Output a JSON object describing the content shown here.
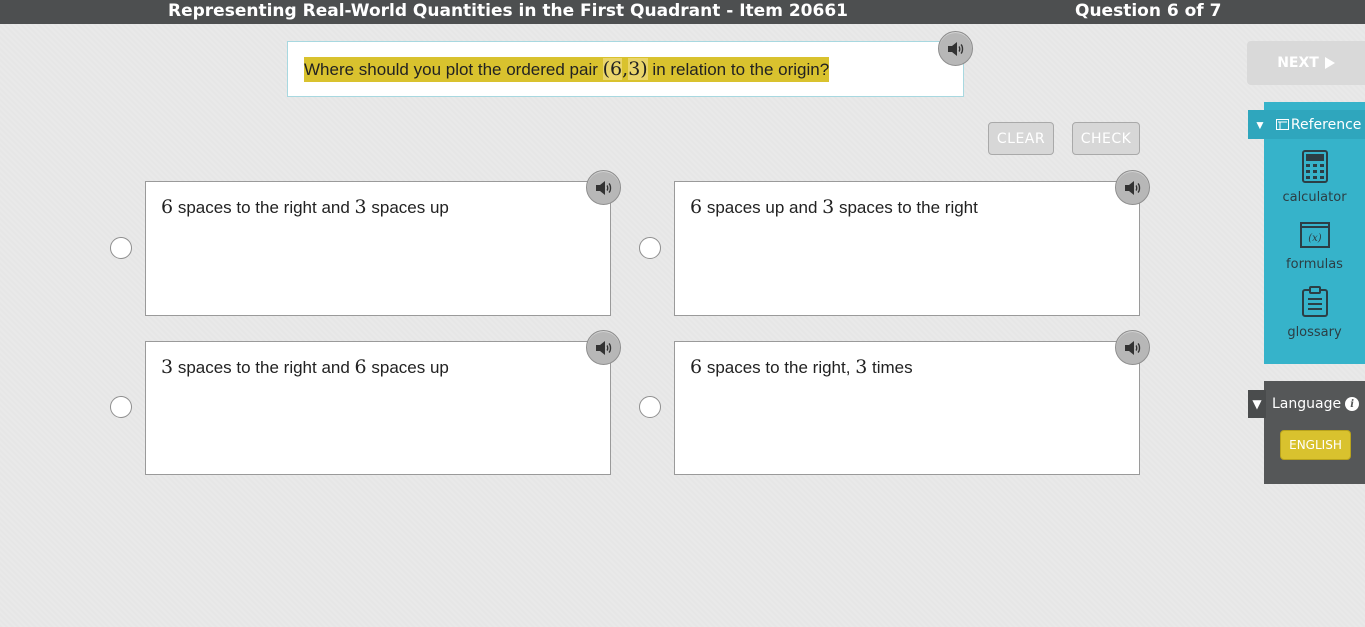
{
  "header": {
    "title": "Representing Real-World Quantities in the First Quadrant - Item 20661",
    "question_count": "Question 6 of 7"
  },
  "question": {
    "text_before": "Where should you plot the ordered pair ",
    "pair_open": "(",
    "pair_x": "6",
    "pair_sep": ",",
    "pair_y": "3",
    "pair_close": ")",
    "text_after": " in relation to the origin?"
  },
  "actions": {
    "clear_label": "CLEAR",
    "check_label": "CHECK",
    "next_label": "NEXT"
  },
  "choices": [
    {
      "num1": "6",
      "text1": " spaces to the right and ",
      "num2": "3",
      "text2": " spaces up"
    },
    {
      "num1": "6",
      "text1": " spaces up and ",
      "num2": "3",
      "text2": " spaces to the right"
    },
    {
      "num1": "3",
      "text1": " spaces to the right and ",
      "num2": "6",
      "text2": " spaces up"
    },
    {
      "num1": "6",
      "text1": " spaces to the right, ",
      "num2": "3",
      "text2": " times"
    }
  ],
  "reference": {
    "title": "Reference",
    "tools": [
      {
        "label": "calculator",
        "icon": "calculator-icon"
      },
      {
        "label": "formulas",
        "icon": "formulas-icon"
      },
      {
        "label": "glossary",
        "icon": "glossary-icon"
      }
    ],
    "formula_glyph": "(x)"
  },
  "language": {
    "title": "Language",
    "selected": "ENGLISH"
  },
  "colors": {
    "highlight": "#d9c22e",
    "reference_panel": "#36b3ca",
    "header_bar": "#4d4f50"
  }
}
